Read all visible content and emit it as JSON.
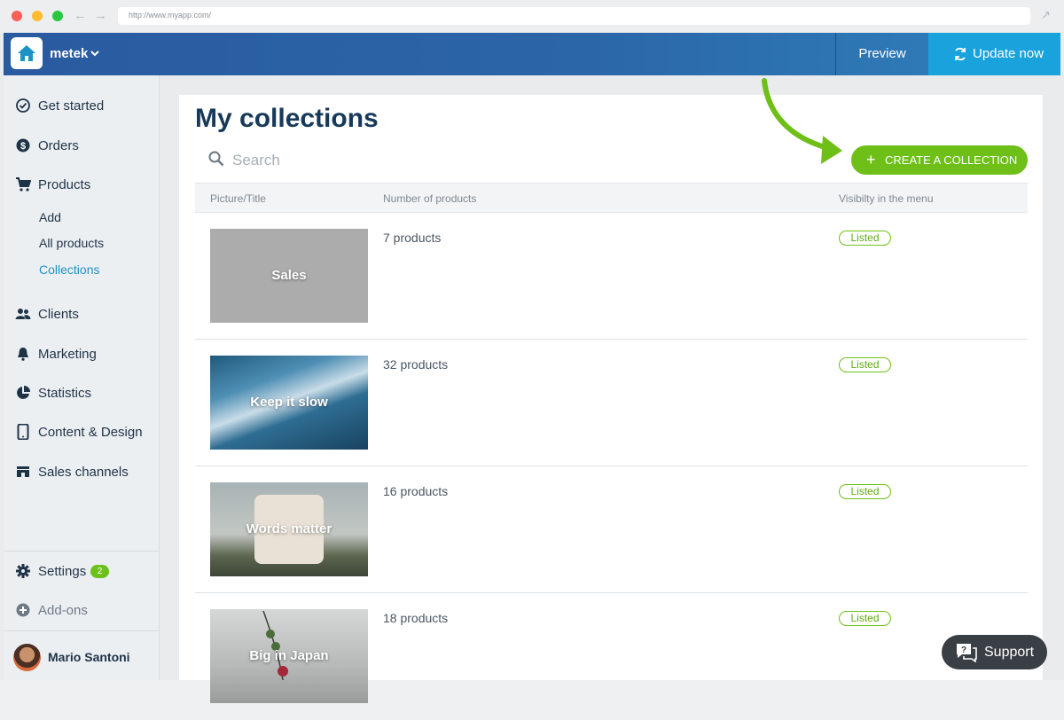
{
  "browser": {
    "url": "http://www.myapp.com/"
  },
  "header": {
    "store_name": "metek",
    "preview_label": "Preview",
    "update_label": "Update now"
  },
  "sidebar": {
    "items": [
      {
        "label": "Get started",
        "icon": "check-circle-icon"
      },
      {
        "label": "Orders",
        "icon": "dollar-circle-icon"
      },
      {
        "label": "Products",
        "icon": "cart-icon"
      },
      {
        "label": "Clients",
        "icon": "people-icon"
      },
      {
        "label": "Marketing",
        "icon": "bell-icon"
      },
      {
        "label": "Statistics",
        "icon": "pie-chart-icon"
      },
      {
        "label": "Content & Design",
        "icon": "phone-icon"
      },
      {
        "label": "Sales channels",
        "icon": "store-icon"
      }
    ],
    "products_sub": [
      "Add",
      "All products",
      "Collections"
    ],
    "settings_label": "Settings",
    "settings_badge": "2",
    "addons_label": "Add-ons",
    "user_name": "Mario Santoni"
  },
  "main": {
    "title": "My collections",
    "search_placeholder": "Search",
    "create_label": "CREATE A COLLECTION",
    "columns": [
      "Picture/Title",
      "Number of products",
      "Visibilty in the menu"
    ],
    "rows": [
      {
        "title": "Sales",
        "count": "7 products",
        "status": "Listed"
      },
      {
        "title": "Keep it slow",
        "count": "32 products",
        "status": "Listed"
      },
      {
        "title": "Words matter",
        "count": "16 products",
        "status": "Listed"
      },
      {
        "title": "Big in Japan",
        "count": "18 products",
        "status": "Listed"
      }
    ]
  },
  "support_label": "Support",
  "colors": {
    "accent_green": "#6ebf17",
    "header_blue": "#2b66a8",
    "update_blue": "#19a2dc",
    "active_link": "#1c93c6"
  }
}
